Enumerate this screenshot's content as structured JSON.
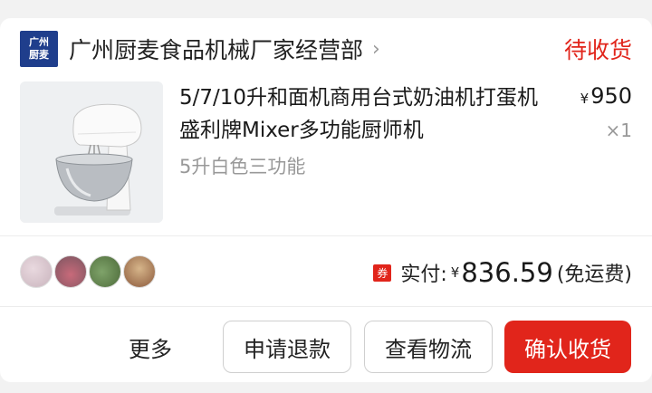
{
  "store": {
    "logo_text": "广州厨麦",
    "name": "广州厨麦食品机械厂家经营部",
    "chevron": "›"
  },
  "order": {
    "status": "待收货",
    "status_color": "#e1251b"
  },
  "product": {
    "title": "5/7/10升和面机商用台式奶油机打蛋机盛利牌Mixer多功能厨师机",
    "spec": "5升白色三功能",
    "currency": "¥",
    "price": "950",
    "quantity": "×1"
  },
  "summary": {
    "coupon_badge": "券",
    "paid_label": "实付:",
    "currency": "¥",
    "paid_amount": "836.59",
    "shipping_note": "(免运费)"
  },
  "actions": {
    "more": "更多",
    "refund": "申请退款",
    "logistics": "查看物流",
    "confirm": "确认收货"
  },
  "colors": {
    "accent": "#e1251b",
    "brand": "#1f3e8c"
  }
}
